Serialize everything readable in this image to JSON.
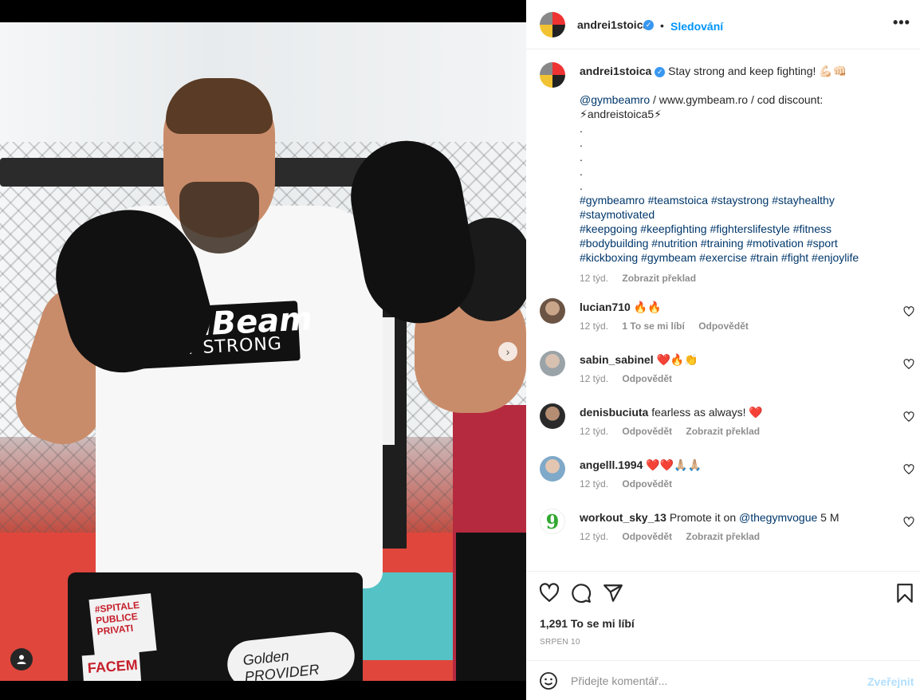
{
  "post": {
    "username": "andrei1stoica",
    "follow_label": "Sledování",
    "more_label": "•••",
    "caption": {
      "text": "Stay strong and keep fighting! 💪🏻👊🏻",
      "mention": "@gymbeamro",
      "line2_rest": " / www.gymbeam.ro / cod discount:",
      "line3": "⚡andreistoica5⚡",
      "dots": [
        ".",
        ".",
        ".",
        ".",
        "."
      ],
      "hashtags": [
        "#gymbeamro #teamstoica #staystrong #stayhealthy",
        "#staymotivated",
        "#keepgoing #keepfighting #fighterslifestyle #fitness",
        "#bodybuilding #nutrition #training #motivation #sport",
        "#kickboxing #gymbeam #exercise #train #fight #enjoylife"
      ],
      "time": "12 týd.",
      "translate": "Zobrazit překlad"
    },
    "comments": [
      {
        "user": "lucian710",
        "text": "🔥🔥",
        "time": "12 týd.",
        "likes": "1 To se mi líbí",
        "reply": "Odpovědět",
        "translate": ""
      },
      {
        "user": "sabin_sabinel",
        "text": "❤️🔥👏",
        "time": "12 týd.",
        "likes": "",
        "reply": "Odpovědět",
        "translate": ""
      },
      {
        "user": "denisbuciuta",
        "text": "fearless as always! ❤️",
        "time": "12 týd.",
        "likes": "",
        "reply": "Odpovědět",
        "translate": "Zobrazit překlad"
      },
      {
        "user": "angelll.1994",
        "text": "❤️❤️🙏🏼🙏🏼",
        "time": "12 týd.",
        "likes": "",
        "reply": "Odpovědět",
        "translate": ""
      },
      {
        "user": "workout_sky_13",
        "text": "Promote it on ",
        "mention": "@thegymvogue",
        "suffix": " 5 M",
        "time": "12 týd.",
        "likes": "",
        "reply": "Odpovědět",
        "translate": "Zobrazit překlad"
      }
    ],
    "likes_count": "1,291 To se mi líbí",
    "date": "SRPEN 10",
    "comment_placeholder": "Přidejte komentář...",
    "post_label": "Zveřejnit"
  },
  "media": {
    "logo_main": "GymBeam",
    "logo_sub": "STAY STRONG",
    "patch1": "#SPITALE PUBLICE PRIVATI",
    "patch2": "Golden PROVIDER",
    "patch3": "FACEM"
  },
  "icons": {
    "like": "heart-icon",
    "comment": "comment-icon",
    "share": "share-icon",
    "save": "bookmark-icon",
    "emoji": "smiley-icon",
    "next": "chevron-right-icon",
    "tags": "user-icon"
  },
  "colors": {
    "accent": "#0095f6",
    "link": "#00376b",
    "muted": "#8e8e8e",
    "post_disabled": "#b2dffc"
  }
}
